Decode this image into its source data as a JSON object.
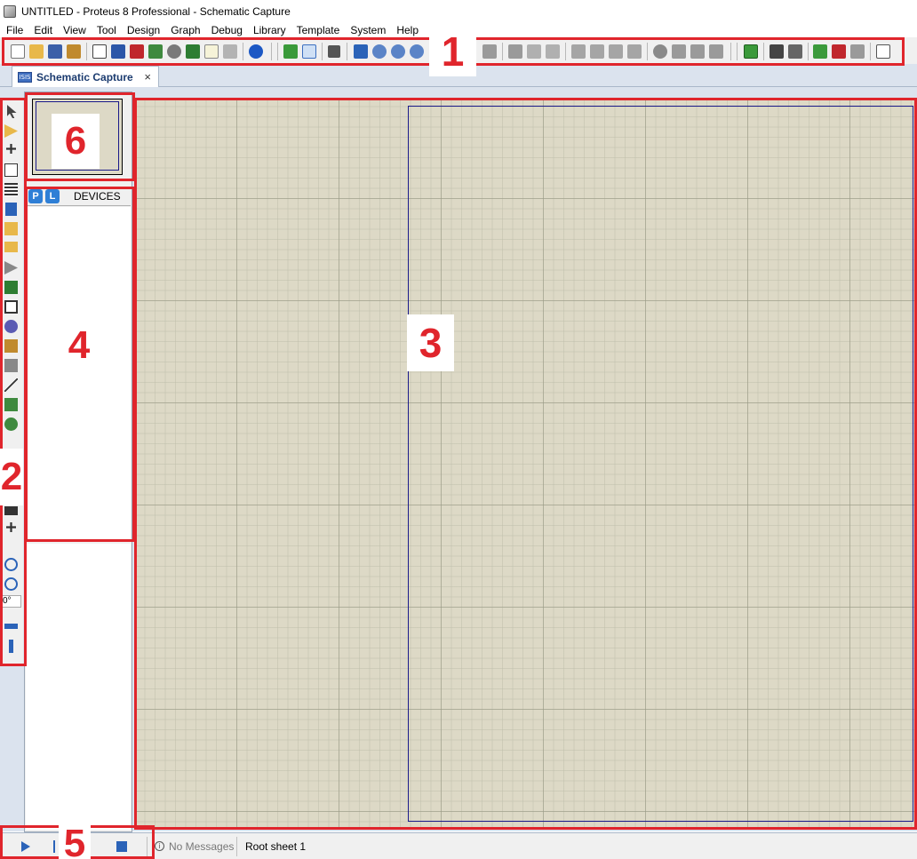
{
  "window": {
    "title": "UNTITLED - Proteus 8 Professional - Schematic Capture"
  },
  "menubar": [
    "File",
    "Edit",
    "View",
    "Tool",
    "Design",
    "Graph",
    "Debug",
    "Library",
    "Template",
    "System",
    "Help"
  ],
  "tab": {
    "label": "Schematic Capture",
    "icon": "ISIS",
    "close": "×"
  },
  "devices_panel": {
    "p_button": "P",
    "l_button": "L",
    "title": "DEVICES"
  },
  "left_toolbar": {
    "rotation": "0°"
  },
  "status": {
    "messages": "No Messages",
    "sheet": "Root sheet 1",
    "info_glyph": "i"
  },
  "annotations": {
    "toolbar": "1",
    "left_toolbar": "2",
    "canvas": "3",
    "devices": "4",
    "sim_controls": "5",
    "overview": "6"
  },
  "colors": {
    "annotation": "#e0252c",
    "canvas": "#ddd9c6",
    "sheet_border": "#1a1a8a",
    "accent": "#2b63b8"
  }
}
